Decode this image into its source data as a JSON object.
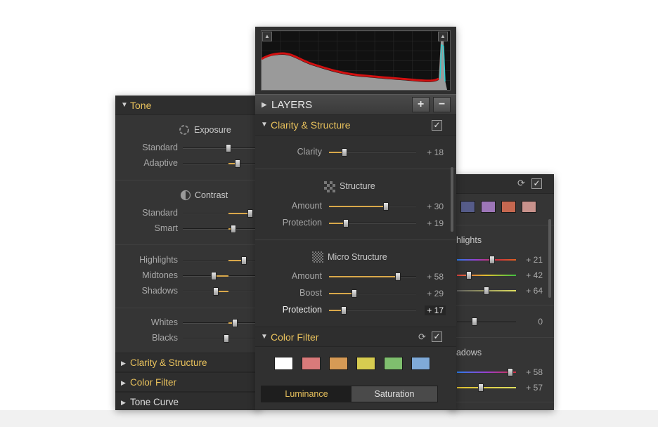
{
  "left_panel": {
    "tone_title": "Tone",
    "exposure": {
      "title": "Exposure",
      "rows": [
        {
          "label": "Standard",
          "value": 0.5
        },
        {
          "label": "Adaptive",
          "value": 0.6
        }
      ]
    },
    "contrast": {
      "title": "Contrast",
      "rows": [
        {
          "label": "Standard",
          "value": 0.74
        },
        {
          "label": "Smart",
          "value": 0.55
        }
      ]
    },
    "tonal": {
      "rows": [
        {
          "label": "Highlights",
          "value": 0.67
        },
        {
          "label": "Midtones",
          "value": 0.34
        },
        {
          "label": "Shadows",
          "value": 0.36
        }
      ]
    },
    "wb": {
      "rows": [
        {
          "label": "Whites",
          "value": 0.57
        },
        {
          "label": "Blacks",
          "value": 0.48
        }
      ]
    },
    "collapsed": [
      "Clarity & Structure",
      "Color Filter",
      "Tone Curve"
    ]
  },
  "center_panel": {
    "layers_title": "LAYERS",
    "add_label": "+",
    "remove_label": "−",
    "cs_title": "Clarity & Structure",
    "clarity": {
      "label": "Clarity",
      "display": "+ 18",
      "value": 0.18
    },
    "structure_title": "Structure",
    "structure_rows": [
      {
        "label": "Amount",
        "display": "+ 30",
        "value": 0.65
      },
      {
        "label": "Protection",
        "display": "+ 19",
        "value": 0.19
      }
    ],
    "micro_title": "Micro Structure",
    "micro_rows": [
      {
        "label": "Amount",
        "display": "+ 58",
        "value": 0.79
      },
      {
        "label": "Boost",
        "display": "+ 29",
        "value": 0.29
      },
      {
        "label": "Protection",
        "display": "+ 17",
        "value": 0.17
      }
    ],
    "cf_title": "Color Filter",
    "filter_colors": [
      "#ffffff",
      "#d97a7a",
      "#d69a55",
      "#d7cc50",
      "#7fbf6e",
      "#7faad8"
    ],
    "tabs": [
      "Luminance",
      "Saturation"
    ],
    "active_tab": "Luminance"
  },
  "right_panel": {
    "swatches": [
      "#565c8a",
      "#9d76b8",
      "#c66850",
      "#c8928c"
    ],
    "highlights_title": "ghlights",
    "highlights_rows": [
      {
        "display": "+ 21",
        "value": 0.6
      },
      {
        "display": "+ 42",
        "value": 0.2
      },
      {
        "display": "+ 64",
        "value": 0.5
      }
    ],
    "middle_row": {
      "display": "0",
      "value": 0.3
    },
    "shadows_title": "hadows",
    "shadows_rows": [
      {
        "display": "+ 58",
        "value": 0.9
      },
      {
        "display": "+ 57",
        "value": 0.4
      }
    ]
  },
  "colors": {
    "accent": "#e8c15c",
    "panel_bg": "#353535",
    "slider_fill": "#d9a84a"
  }
}
